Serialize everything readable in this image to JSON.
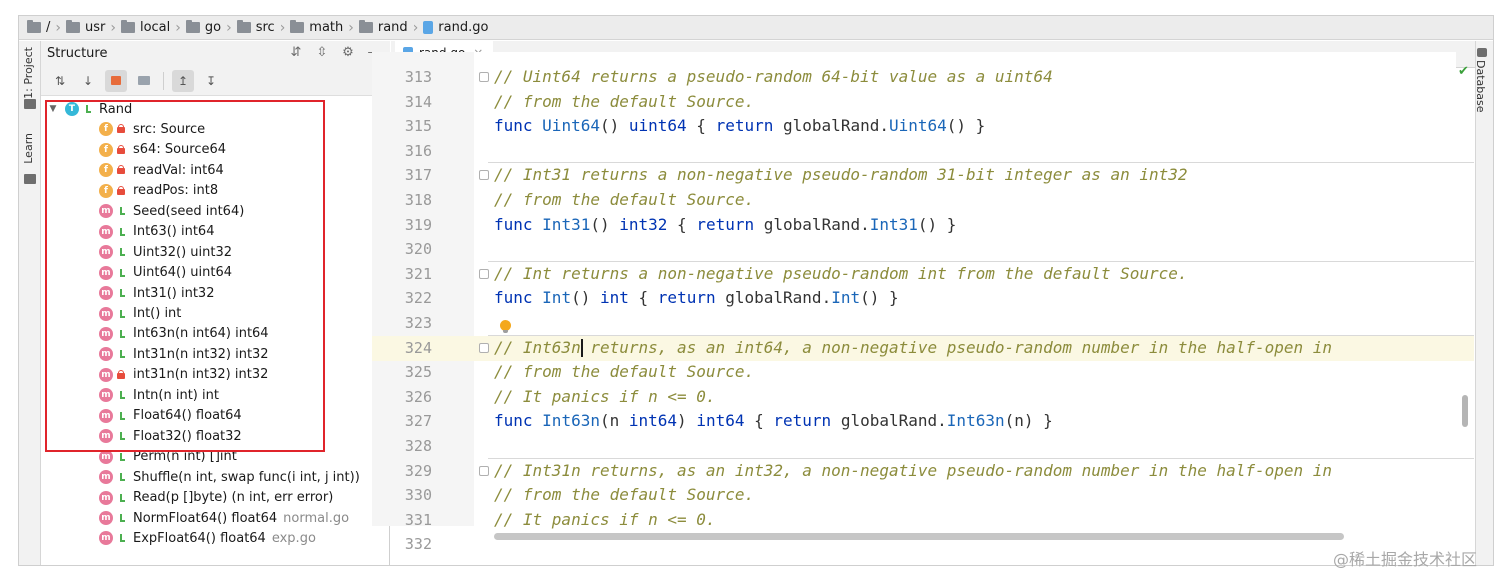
{
  "breadcrumb": {
    "items": [
      {
        "label": "/",
        "icon": "folder-icon"
      },
      {
        "label": "usr",
        "icon": "folder-icon"
      },
      {
        "label": "local",
        "icon": "folder-icon"
      },
      {
        "label": "go",
        "icon": "folder-icon"
      },
      {
        "label": "src",
        "icon": "folder-icon"
      },
      {
        "label": "math",
        "icon": "folder-icon"
      },
      {
        "label": "rand",
        "icon": "folder-icon"
      },
      {
        "label": "rand.go",
        "icon": "go-file-icon"
      }
    ],
    "separator": "›"
  },
  "left_strip": {
    "project_tab": "1: Project",
    "learn_tab": "Learn"
  },
  "right_strip": {
    "database_tab": "Database"
  },
  "structure": {
    "title": "Structure",
    "root": {
      "badge": "T",
      "label": "Rand"
    },
    "items": [
      {
        "badge": "f",
        "access": "private",
        "label": "src: Source",
        "file": ""
      },
      {
        "badge": "f",
        "access": "private",
        "label": "s64: Source64",
        "file": ""
      },
      {
        "badge": "f",
        "access": "private",
        "label": "readVal: int64",
        "file": ""
      },
      {
        "badge": "f",
        "access": "private",
        "label": "readPos: int8",
        "file": ""
      },
      {
        "badge": "m",
        "access": "public",
        "label": "Seed(seed int64)",
        "file": ""
      },
      {
        "badge": "m",
        "access": "public",
        "label": "Int63() int64",
        "file": ""
      },
      {
        "badge": "m",
        "access": "public",
        "label": "Uint32() uint32",
        "file": ""
      },
      {
        "badge": "m",
        "access": "public",
        "label": "Uint64() uint64",
        "file": ""
      },
      {
        "badge": "m",
        "access": "public",
        "label": "Int31() int32",
        "file": ""
      },
      {
        "badge": "m",
        "access": "public",
        "label": "Int() int",
        "file": ""
      },
      {
        "badge": "m",
        "access": "public",
        "label": "Int63n(n int64) int64",
        "file": ""
      },
      {
        "badge": "m",
        "access": "public",
        "label": "Int31n(n int32) int32",
        "file": ""
      },
      {
        "badge": "m",
        "access": "private",
        "label": "int31n(n int32) int32",
        "file": ""
      },
      {
        "badge": "m",
        "access": "public",
        "label": "Intn(n int) int",
        "file": ""
      },
      {
        "badge": "m",
        "access": "public",
        "label": "Float64() float64",
        "file": ""
      },
      {
        "badge": "m",
        "access": "public",
        "label": "Float32() float32",
        "file": ""
      },
      {
        "badge": "m",
        "access": "public",
        "label": "Perm(n int) []int",
        "file": ""
      },
      {
        "badge": "m",
        "access": "public",
        "label": "Shuffle(n int, swap func(i int, j int))",
        "file": ""
      },
      {
        "badge": "m",
        "access": "public",
        "label": "Read(p []byte) (n int, err error)",
        "file": ""
      },
      {
        "badge": "m",
        "access": "public",
        "label": "NormFloat64() float64",
        "file": "normal.go"
      },
      {
        "badge": "m",
        "access": "public",
        "label": "ExpFloat64() float64",
        "file": "exp.go"
      }
    ]
  },
  "editor": {
    "tab_label": "rand.go",
    "lines": [
      {
        "no": "313",
        "tokens": [
          [
            "com",
            "// Uint64 returns a pseudo-random 64-bit value as a uint64"
          ]
        ]
      },
      {
        "no": "314",
        "tokens": [
          [
            "com",
            "// from the default Source."
          ]
        ]
      },
      {
        "no": "315",
        "tokens": [
          [
            "kw",
            "func "
          ],
          [
            "fn",
            "Uint64"
          ],
          [
            "p",
            "() "
          ],
          [
            "type",
            "uint64"
          ],
          [
            "p",
            " { "
          ],
          [
            "kw",
            "return "
          ],
          [
            "p",
            "globalRand."
          ],
          [
            "fn",
            "Uint64"
          ],
          [
            "p",
            "() }"
          ]
        ]
      },
      {
        "no": "316",
        "tokens": []
      },
      {
        "no": "317",
        "tokens": [
          [
            "com",
            "// Int31 returns a non-negative pseudo-random 31-bit integer as an int32"
          ]
        ]
      },
      {
        "no": "318",
        "tokens": [
          [
            "com",
            "// from the default Source."
          ]
        ]
      },
      {
        "no": "319",
        "tokens": [
          [
            "kw",
            "func "
          ],
          [
            "fn",
            "Int31"
          ],
          [
            "p",
            "() "
          ],
          [
            "type",
            "int32"
          ],
          [
            "p",
            " { "
          ],
          [
            "kw",
            "return "
          ],
          [
            "p",
            "globalRand."
          ],
          [
            "fn",
            "Int31"
          ],
          [
            "p",
            "() }"
          ]
        ]
      },
      {
        "no": "320",
        "tokens": []
      },
      {
        "no": "321",
        "tokens": [
          [
            "com",
            "// Int returns a non-negative pseudo-random int from the default Source."
          ]
        ]
      },
      {
        "no": "322",
        "tokens": [
          [
            "kw",
            "func "
          ],
          [
            "fn",
            "Int"
          ],
          [
            "p",
            "() "
          ],
          [
            "type",
            "int"
          ],
          [
            "p",
            " { "
          ],
          [
            "kw",
            "return "
          ],
          [
            "p",
            "globalRand."
          ],
          [
            "fn",
            "Int"
          ],
          [
            "p",
            "() }"
          ]
        ]
      },
      {
        "no": "323",
        "tokens": []
      },
      {
        "no": "324",
        "tokens": [
          [
            "com",
            "// Int63n returns, as an int64, a non-negative pseudo-random number in the half-open in"
          ]
        ]
      },
      {
        "no": "325",
        "tokens": [
          [
            "com",
            "// from the default Source."
          ]
        ]
      },
      {
        "no": "326",
        "tokens": [
          [
            "com",
            "// It panics if n <= 0."
          ]
        ]
      },
      {
        "no": "327",
        "tokens": [
          [
            "kw",
            "func "
          ],
          [
            "fn",
            "Int63n"
          ],
          [
            "p",
            "(n "
          ],
          [
            "type",
            "int64"
          ],
          [
            "p",
            ") "
          ],
          [
            "type",
            "int64"
          ],
          [
            "p",
            " { "
          ],
          [
            "kw",
            "return "
          ],
          [
            "p",
            "globalRand."
          ],
          [
            "fn",
            "Int63n"
          ],
          [
            "p",
            "(n) }"
          ]
        ]
      },
      {
        "no": "328",
        "tokens": []
      },
      {
        "no": "329",
        "tokens": [
          [
            "com",
            "// Int31n returns, as an int32, a non-negative pseudo-random number in the half-open in"
          ]
        ]
      },
      {
        "no": "330",
        "tokens": [
          [
            "com",
            "// from the default Source."
          ]
        ]
      },
      {
        "no": "331",
        "tokens": [
          [
            "com",
            "// It panics if n <= 0."
          ]
        ]
      },
      {
        "no": "332",
        "tokens": []
      }
    ]
  },
  "watermark": "@稀土掘金技术社区",
  "colors": {
    "highlight_box": "#e0242b",
    "comment": "#8c8c3c",
    "keyword": "#0033b3",
    "current_line": "#fbf8e3"
  }
}
